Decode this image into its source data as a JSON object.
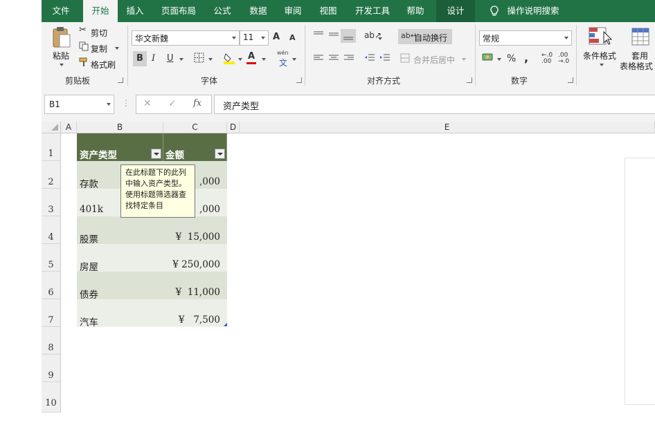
{
  "tabs": [
    "文件",
    "开始",
    "插入",
    "页面布局",
    "公式",
    "数据",
    "审阅",
    "视图",
    "开发工具",
    "帮助",
    "设计"
  ],
  "tell_me": "操作说明搜索",
  "clipboard": {
    "paste": "粘贴",
    "cut": "剪切",
    "copy": "复制",
    "format_painter": "格式刷",
    "label": "剪贴板"
  },
  "font": {
    "name": "华文新魏",
    "size": "11",
    "label": "字体",
    "bold": "B",
    "italic": "I",
    "underline": "U",
    "grow": "A",
    "shrink": "A",
    "phonetic_top": "wén",
    "phonetic_bottom": "文"
  },
  "alignment": {
    "wrap": "自动换行",
    "merge": "合并后居中",
    "label": "对齐方式"
  },
  "number": {
    "format": "常规",
    "percent": "%",
    "comma": ",",
    "label": "数字"
  },
  "styles": {
    "conditional": "条件格式",
    "table_line1": "套用",
    "table_line2": "表格格式"
  },
  "formula_bar": {
    "name_box": "B1",
    "fx": "fx",
    "value": "资产类型"
  },
  "columns": [
    "A",
    "B",
    "C",
    "D",
    "E"
  ],
  "rows": [
    "1",
    "2",
    "3",
    "4",
    "5",
    "6",
    "7",
    "8",
    "9",
    "10"
  ],
  "table": {
    "headers": [
      "资产类型",
      "金额"
    ],
    "items": [
      {
        "type": "存款",
        "amount": ",000"
      },
      {
        "type": "401k",
        "amount": ",000"
      },
      {
        "type": "股票",
        "amount": "¥  15,000"
      },
      {
        "type": "房屋",
        "amount": "¥ 250,000"
      },
      {
        "type": "债券",
        "amount": "¥  11,000"
      },
      {
        "type": "汽车",
        "amount": "¥   7,500"
      }
    ]
  },
  "tooltip": [
    "在此标题下的此列",
    "中输入资产类型。",
    "使用标题筛选器查",
    "找特定条目"
  ],
  "colors": {
    "excel_green": "#217346",
    "header_fill": "#5a6e45",
    "band_dark": "#dce3d4",
    "band_light": "#ecefe8",
    "tooltip_bg": "#ffffe1"
  }
}
